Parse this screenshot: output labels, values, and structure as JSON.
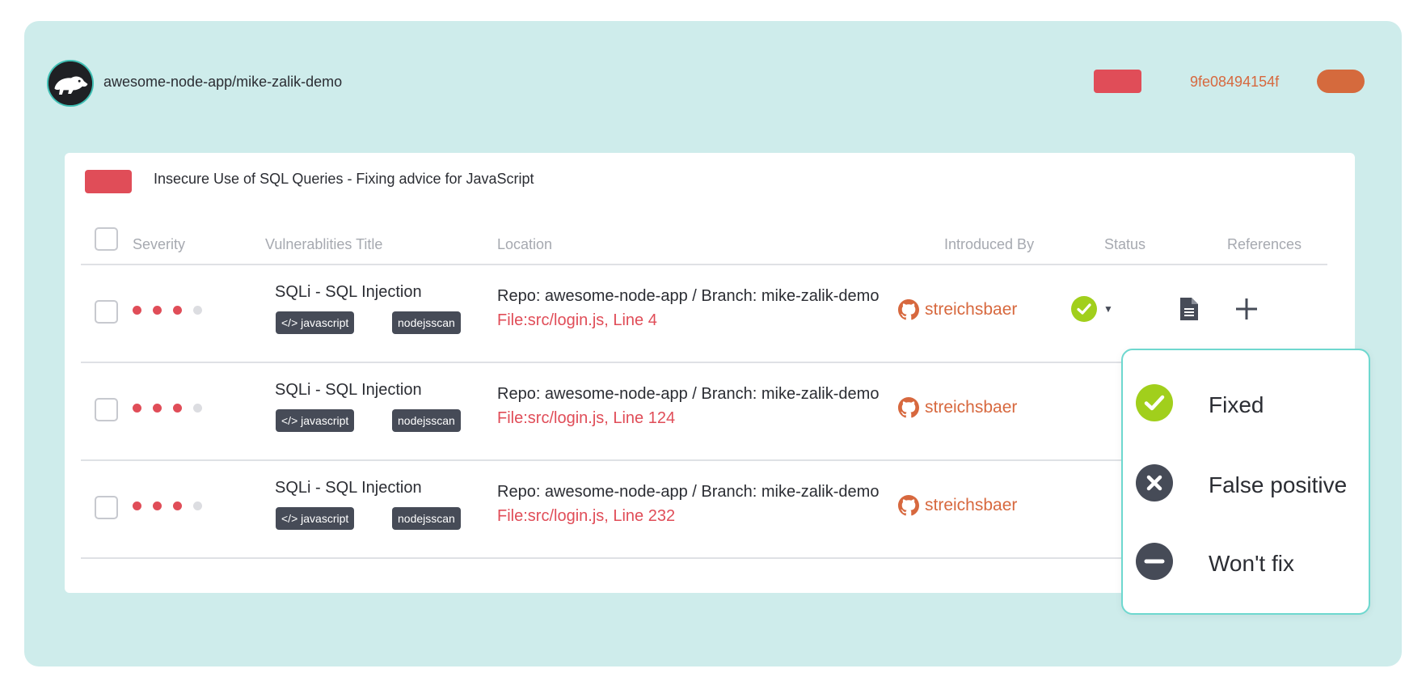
{
  "header": {
    "repo": "awesome-node-app/mike-zalik-demo",
    "commit": "9fe08494154f"
  },
  "card": {
    "title": "Insecure Use of SQL Queries - Fixing advice for JavaScript"
  },
  "columns": {
    "severity": "Severity",
    "title": "Vulnerablities Title",
    "location": "Location",
    "introduced_by": "Introduced By",
    "status": "Status",
    "references": "References"
  },
  "rows": [
    {
      "severity": 3,
      "title": "SQLi - SQL Injection",
      "tags": [
        "</> javascript",
        "nodejsscan"
      ],
      "location_repo": "Repo: awesome-node-app / Branch: mike-zalik-demo",
      "location_file": "File:src/login.js, Line 4",
      "author": "streichsbaer",
      "status": "fixed"
    },
    {
      "severity": 3,
      "title": "SQLi - SQL Injection",
      "tags": [
        "</> javascript",
        "nodejsscan"
      ],
      "location_repo": "Repo: awesome-node-app / Branch: mike-zalik-demo",
      "location_file": "File:src/login.js, Line 124",
      "author": "streichsbaer"
    },
    {
      "severity": 3,
      "title": "SQLi - SQL Injection",
      "tags": [
        "</> javascript",
        "nodejsscan"
      ],
      "location_repo": "Repo: awesome-node-app / Branch: mike-zalik-demo",
      "location_file": "File:src/login.js, Line 232",
      "author": "streichsbaer"
    }
  ],
  "status_menu": {
    "options": [
      {
        "label": "Fixed",
        "icon": "check-icon",
        "color": "#a1cf1c"
      },
      {
        "label": "False positive",
        "icon": "x-icon",
        "color": "#464b57"
      },
      {
        "label": "Won't fix",
        "icon": "minus-icon",
        "color": "#464b57"
      }
    ]
  },
  "colors": {
    "background": "#ceeceb",
    "accent_red": "#e04d58",
    "accent_orange": "#d7683e",
    "check_green": "#a1cf1c",
    "tag_dark": "#464b57"
  }
}
